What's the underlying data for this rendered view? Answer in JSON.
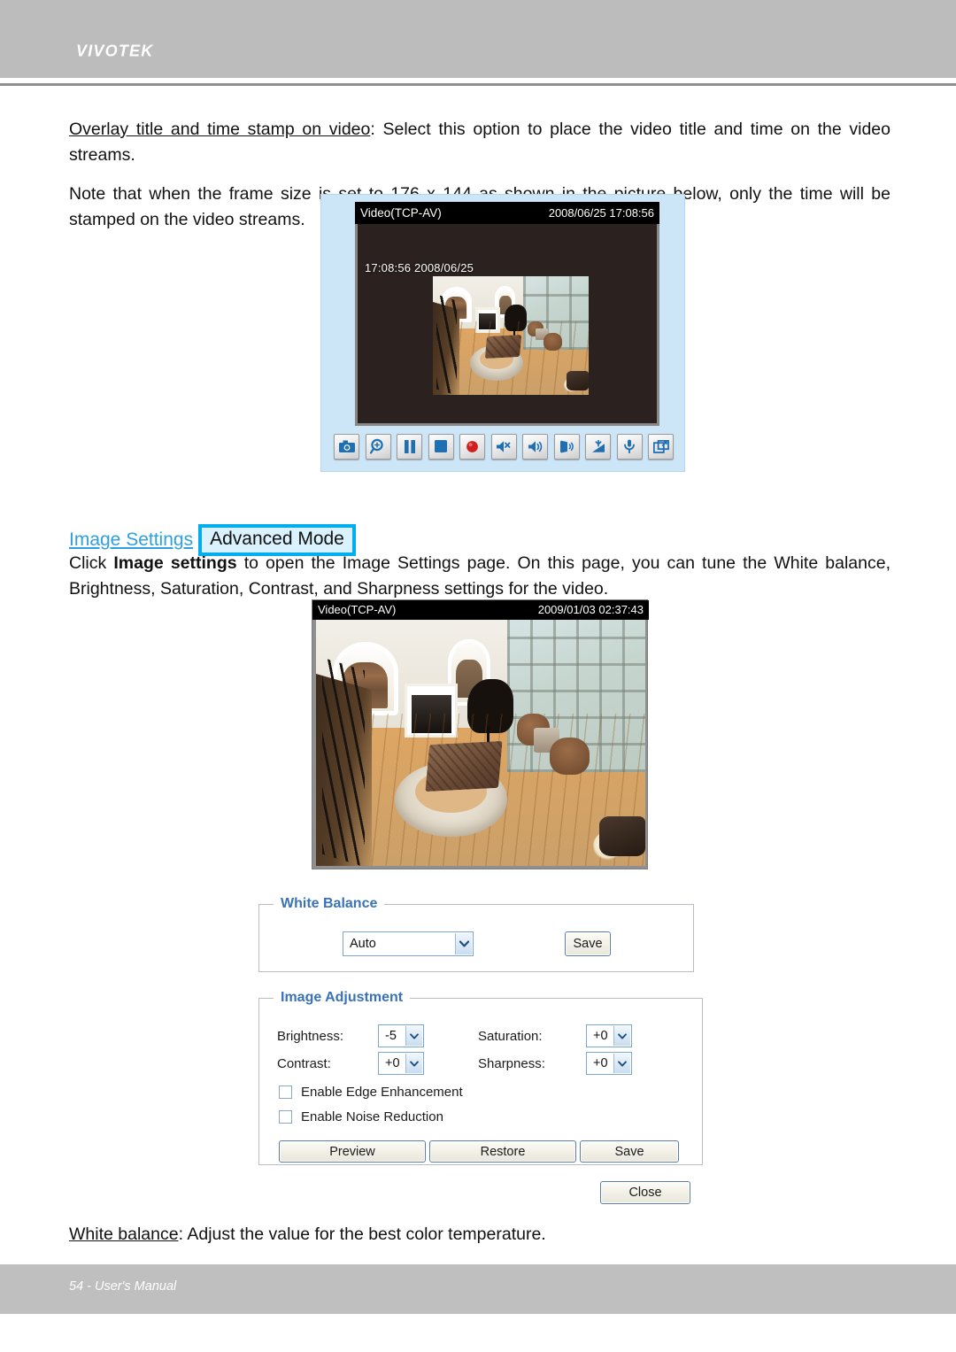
{
  "header": {
    "brand": "VIVOTEK"
  },
  "body": {
    "para1_link": "Overlay title and time stamp on video",
    "para1_rest": ": Select this option to place the video title and time on the video streams.",
    "para2": "Note that when the frame size is set to 176 x 144 as shown in the picture below, only the time will be stamped on the video streams.",
    "para3_lead": "Click ",
    "para3_bold": "Image settings",
    "para3_rest": " to open the Image Settings page. On this page, you can tune the White balance, Brightness, Saturation, Contrast, and Sharpness settings for the video.",
    "para4_link": "White balance",
    "para4_rest": ": Adjust the value for the best color temperature."
  },
  "image_settings_heading": {
    "link": "Image Settings",
    "badge": "Advanced Mode"
  },
  "player1": {
    "title": "Video(TCP-AV)",
    "timestamp": "2008/06/25 17:08:56",
    "overlay_stamp": "17:08:56 2008/06/25",
    "toolbar": [
      {
        "name": "snapshot-icon",
        "label": "Snapshot"
      },
      {
        "name": "digital-zoom-icon",
        "label": "Digital Zoom"
      },
      {
        "name": "pause-icon",
        "label": "Pause"
      },
      {
        "name": "stop-icon",
        "label": "Stop"
      },
      {
        "name": "record-icon",
        "label": "Start MP4 Recording"
      },
      {
        "name": "volume-mute-icon",
        "label": "Mute"
      },
      {
        "name": "volume-icon",
        "label": "Volume"
      },
      {
        "name": "talk-icon",
        "label": "Talk"
      },
      {
        "name": "mic-volume-icon",
        "label": "Mic Volume"
      },
      {
        "name": "microphone-icon",
        "label": "Microphone"
      },
      {
        "name": "fullscreen-icon",
        "label": "Full Screen"
      }
    ]
  },
  "player2": {
    "title": "Video(TCP-AV)",
    "timestamp": "2009/01/03 02:37:43"
  },
  "white_balance": {
    "legend": "White Balance",
    "select_value": "Auto",
    "save_label": "Save"
  },
  "image_adjustment": {
    "legend": "Image Adjustment",
    "fields": [
      {
        "label": "Brightness:",
        "value": "-5"
      },
      {
        "label": "Saturation:",
        "value": "+0"
      },
      {
        "label": "Contrast:",
        "value": "+0"
      },
      {
        "label": "Sharpness:",
        "value": "+0"
      }
    ],
    "checkboxes": [
      {
        "label": "Enable Edge Enhancement",
        "checked": false
      },
      {
        "label": "Enable Noise Reduction",
        "checked": false
      }
    ],
    "buttons": {
      "preview": "Preview",
      "restore": "Restore",
      "save": "Save"
    }
  },
  "close_button": {
    "label": "Close"
  },
  "footer": {
    "text": "54 - User's Manual"
  },
  "colors": {
    "header_gray": "#bcbcbc",
    "link_blue": "#2e9fe0",
    "badge_border": "#00aeef",
    "legend_blue": "#3a72b8",
    "player_bg_blue": "#cde6f7"
  }
}
